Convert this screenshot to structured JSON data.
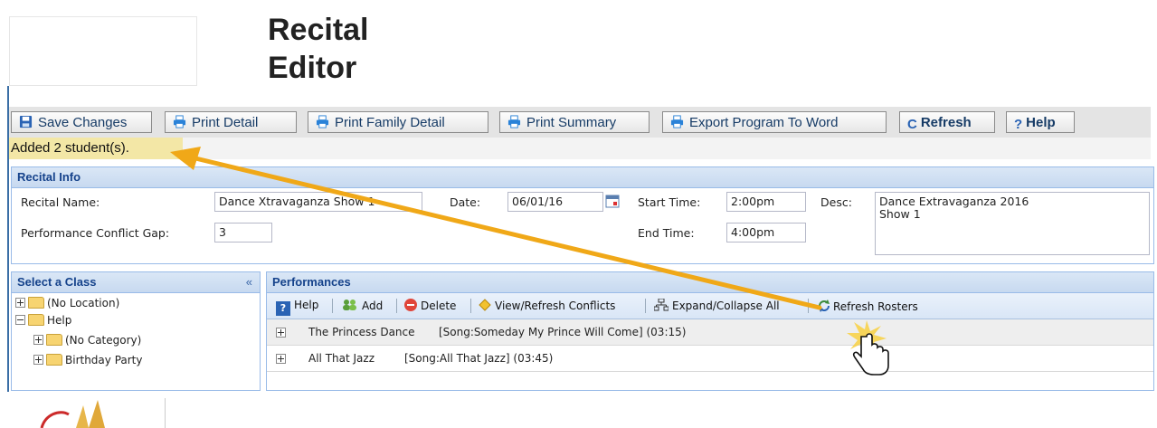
{
  "header": {
    "title_line1": "Recital",
    "title_line2": "Editor"
  },
  "toolbar": {
    "save": "Save Changes",
    "print_detail": "Print Detail",
    "print_family": "Print Family Detail",
    "print_summary": "Print Summary",
    "export_word": "Export Program To Word",
    "refresh": "Refresh",
    "help": "Help"
  },
  "status": {
    "message": "Added 2 student(s)."
  },
  "recital_info": {
    "heading": "Recital Info",
    "name_label": "Recital Name:",
    "name_value": "Dance Xtravaganza Show 1",
    "date_label": "Date:",
    "date_value": "06/01/16",
    "start_label": "Start Time:",
    "start_value": "2:00pm",
    "end_label": "End Time:",
    "end_value": "4:00pm",
    "desc_label": "Desc:",
    "desc_line1": "Dance Extravaganza 2016",
    "desc_line2": "Show 1",
    "gap_label": "Performance Conflict Gap:",
    "gap_value": "3"
  },
  "class_panel": {
    "heading": "Select a Class",
    "collapse": "«",
    "items": [
      "(No Location)",
      "Help",
      "(No Category)",
      "Birthday Party"
    ]
  },
  "performances": {
    "heading": "Performances",
    "toolbar": [
      "Help",
      "Add",
      "Delete",
      "View/Refresh Conflicts",
      "Expand/Collapse All",
      "Refresh Rosters"
    ],
    "rows": [
      {
        "name": "The Princess Dance",
        "song": "[Song:Someday My Prince Will Come] (03:15)"
      },
      {
        "name": "All That Jazz",
        "song": "[Song:All That Jazz] (03:45)"
      }
    ]
  },
  "colors": {
    "arrow": "#f0a818",
    "panel_header": "#c7d9f0",
    "status_bg": "#f3e7a6"
  }
}
